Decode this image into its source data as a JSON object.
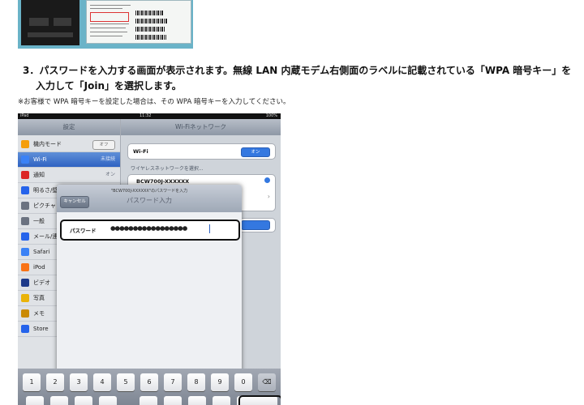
{
  "step": {
    "line1": "3．パスワードを入力する画面が表示されます。無線 LAN 内蔵モデム右側面のラベルに記載されている「WPA 暗号キー」を",
    "line2": "入力して「Join」を選択します。",
    "note": "※お客様で WPA 暗号キーを設定した場合は、その WPA 暗号キーを入力してください。"
  },
  "ipad": {
    "status": {
      "device": "iPad",
      "time": "11:32",
      "battery": "100%"
    },
    "sidebar": {
      "title": "設定",
      "items": [
        {
          "label": "機内モード",
          "value": "オフ",
          "icon": "airplane-icon",
          "color": "#f59e0b"
        },
        {
          "label": "Wi-Fi",
          "value": "未接続",
          "icon": "wifi-icon",
          "color": "#3b82f6",
          "selected": true
        },
        {
          "label": "通知",
          "value": "オン",
          "icon": "notification-icon",
          "color": "#dc2626"
        },
        {
          "label": "明るさ/壁紙",
          "value": "",
          "icon": "brightness-icon",
          "color": "#2563eb"
        },
        {
          "label": "ピクチャ",
          "value": "",
          "icon": "picture-frame-icon",
          "color": "#6b7280"
        },
        {
          "label": "一般",
          "value": "",
          "icon": "gear-icon",
          "color": "#6b7280"
        },
        {
          "label": "メール/連",
          "value": "",
          "icon": "mail-icon",
          "color": "#2563eb"
        },
        {
          "label": "Safari",
          "value": "",
          "icon": "safari-icon",
          "color": "#3b82f6"
        },
        {
          "label": "iPod",
          "value": "",
          "icon": "ipod-icon",
          "color": "#f97316"
        },
        {
          "label": "ビデオ",
          "value": "",
          "icon": "video-icon",
          "color": "#1e3a8a"
        },
        {
          "label": "写真",
          "value": "",
          "icon": "photos-icon",
          "color": "#eab308"
        },
        {
          "label": "メモ",
          "value": "",
          "icon": "notes-icon",
          "color": "#ca8a04"
        },
        {
          "label": "Store",
          "value": "",
          "icon": "store-icon",
          "color": "#2563eb"
        }
      ]
    },
    "main": {
      "title": "Wi-Fiネットワーク",
      "wifi_label": "Wi-Fi",
      "wifi_toggle": "オン",
      "choose_label": "ワイヤレスネットワークを選択...",
      "network_name": "BCW700J-XXXXXX"
    },
    "modal": {
      "prompt": "\"BCW700J-XXXXXX\"のパスワードを入力",
      "title": "パスワード入力",
      "cancel": "キャンセル",
      "password_label": "パスワード",
      "password_dots": "●●●●●●●●●●●●●●●●●"
    },
    "keyboard": {
      "keys": [
        "1",
        "2",
        "3",
        "4",
        "5",
        "6",
        "7",
        "8",
        "9",
        "0"
      ],
      "delete_icon": "backspace-icon"
    }
  }
}
